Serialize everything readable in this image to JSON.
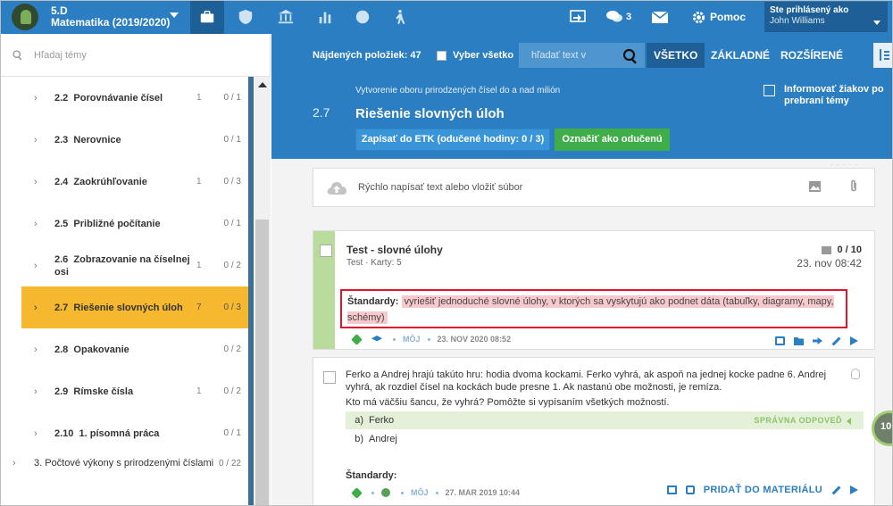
{
  "topbar": {
    "class_code": "5.D",
    "class_subject": "Matematika (2019/2020)",
    "messages_count": "3",
    "help_label": "Pomoc",
    "logged_as_label": "Ste prihlásený ako",
    "user_name": "John Williams",
    "nav_icons": [
      "briefcase-icon",
      "shield-icon",
      "bank-icon",
      "bar-chart-icon",
      "badge-icon",
      "hiking-icon"
    ],
    "right_icons": [
      "cast-icon",
      "chat-icon",
      "mail-icon",
      "gear-icon"
    ]
  },
  "sidebar": {
    "search_placeholder": "Hľadaj témy",
    "topics": [
      {
        "num": "2.2",
        "name": "Porovnávanie čísel",
        "count": "1",
        "progress": "0 / 1"
      },
      {
        "num": "2.3",
        "name": "Nerovnice",
        "count": "",
        "progress": "0 / 1"
      },
      {
        "num": "2.4",
        "name": "Zaokrúhľovanie",
        "count": "1",
        "progress": "0 / 3"
      },
      {
        "num": "2.5",
        "name": "Približné počítanie",
        "count": "",
        "progress": "0 / 1"
      },
      {
        "num": "2.6",
        "name": "Zobrazovanie na číselnej osi",
        "count": "1",
        "progress": "0 / 2"
      },
      {
        "num": "2.7",
        "name": "Riešenie slovných úloh",
        "count": "7",
        "progress": "0 / 3"
      },
      {
        "num": "2.8",
        "name": "Opakovanie",
        "count": "",
        "progress": "0 / 2"
      },
      {
        "num": "2.9",
        "name": "Rímske čísla",
        "count": "1",
        "progress": "0 / 2"
      },
      {
        "num": "2.10",
        "name": "1. písomná práca",
        "count": "",
        "progress": "0 / 1"
      }
    ],
    "chapter": {
      "name": "3. Počtové výkony s prirodzenými číslami",
      "progress": "0 / 22"
    }
  },
  "header": {
    "found_label": "Nájdených položiek: 47",
    "select_all_label": "Vyber všetko",
    "text_search_placeholder": "hľadať text v",
    "tabs": [
      "VŠETKO",
      "ZÁKLADNÉ",
      "ROZŠÍRENÉ"
    ],
    "topic_number": "2.7",
    "topic_subtitle": "Vytvorenie oboru prirodzených čísel do a nad milión",
    "topic_title": "Riešenie slovných úloh",
    "etk_button": "Zapísať do ETK (odučené hodiny: 0 / 3)",
    "done_button": "Označiť ako odučenú",
    "notify_label": "Informovať žiakov po prebraní témy"
  },
  "content": {
    "quick_placeholder": "Rýchlo napísať text alebo vložiť súbor",
    "card1": {
      "title": "Test - slovné úlohy",
      "meta": "Test · Karty: 5",
      "score": "0 / 10",
      "date": "23. nov 08:42",
      "standards_label": "Štandardy:",
      "standard_text": "vyriešiť jednoduché slovné úlohy, v ktorých sa vyskytujú ako podnet dáta (tabuľky, diagramy, mapy, schémy)",
      "owner": "MÔJ",
      "footer_date": "23. NOV 2020 08:52"
    },
    "card2": {
      "question": "Ferko a Andrej hrajú takúto hru: hodia dvoma kockami. Ferko vyhrá, ak aspoň na jednej kocke padne 6. Andrej vyhrá, ak rozdiel čísel na kockách bude presne 1. Ak nastanú obe možnosti, je remíza.",
      "ask": "Kto má väčšiu šancu, že vyhrá? Pomôžte si vypísaním všetkých možností.",
      "options": [
        {
          "letter": "a)",
          "text": "Ferko"
        },
        {
          "letter": "b)",
          "text": "Andrej"
        }
      ],
      "correct_label": "SPRÁVNA ODPOVEĎ",
      "standards_label": "Štandardy:",
      "owner": "MÔJ",
      "footer_date": "27. MAR 2019 10:44",
      "add_material": "PRIDAŤ DO MATERIÁLU"
    },
    "round_badge": "10"
  },
  "colors": {
    "primary": "#2b7ec1",
    "dark_primary": "#1d5f96",
    "active_topic": "#f5b82e",
    "success": "#3fae49",
    "highlight_border": "#e0142a",
    "highlight_bg": "#f7c9cc"
  }
}
